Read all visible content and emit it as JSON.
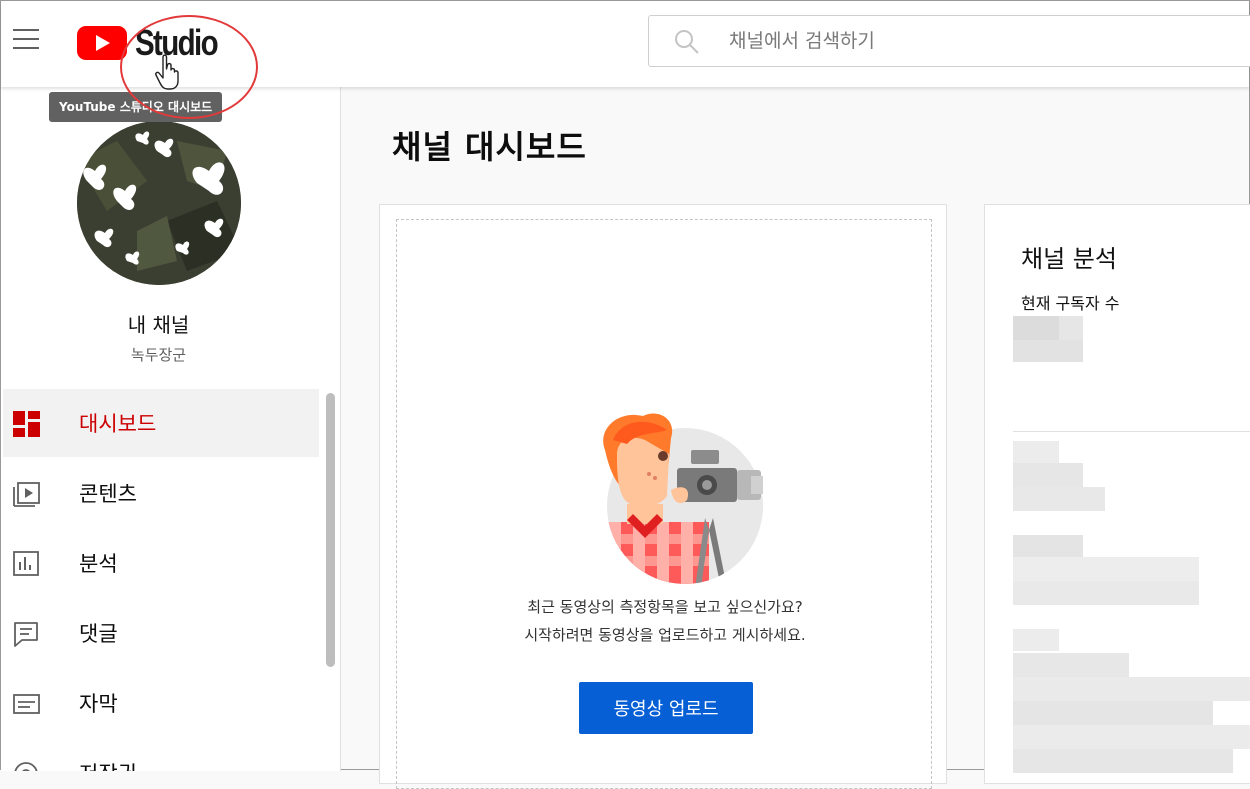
{
  "header": {
    "logo_text": "Studio",
    "tooltip": "YouTube 스튜디오 대시보드",
    "search_placeholder": "채널에서 검색하기"
  },
  "sidebar": {
    "channel_name": "내 채널",
    "channel_sub": "녹두장군",
    "items": [
      {
        "label": "대시보드",
        "icon": "dashboard-icon",
        "active": true
      },
      {
        "label": "콘텐츠",
        "icon": "content-icon",
        "active": false
      },
      {
        "label": "분석",
        "icon": "analytics-icon",
        "active": false
      },
      {
        "label": "댓글",
        "icon": "comments-icon",
        "active": false
      },
      {
        "label": "자막",
        "icon": "subtitles-icon",
        "active": false
      },
      {
        "label": "저작권",
        "icon": "copyright-icon",
        "active": false
      }
    ]
  },
  "main": {
    "title": "채널 대시보드",
    "upload_card": {
      "prompt_line1": "최근 동영상의 측정항목을 보고 싶으신가요?",
      "prompt_line2": "시작하려면 동영상을 업로드하고 게시하세요.",
      "button_label": "동영상 업로드"
    },
    "analytics_card": {
      "title": "채널 분석",
      "subscribers_label": "현재 구독자 수"
    }
  },
  "colors": {
    "accent_red": "#cc0000",
    "button_blue": "#065fd4",
    "annotation_red": "#e23a3a"
  }
}
